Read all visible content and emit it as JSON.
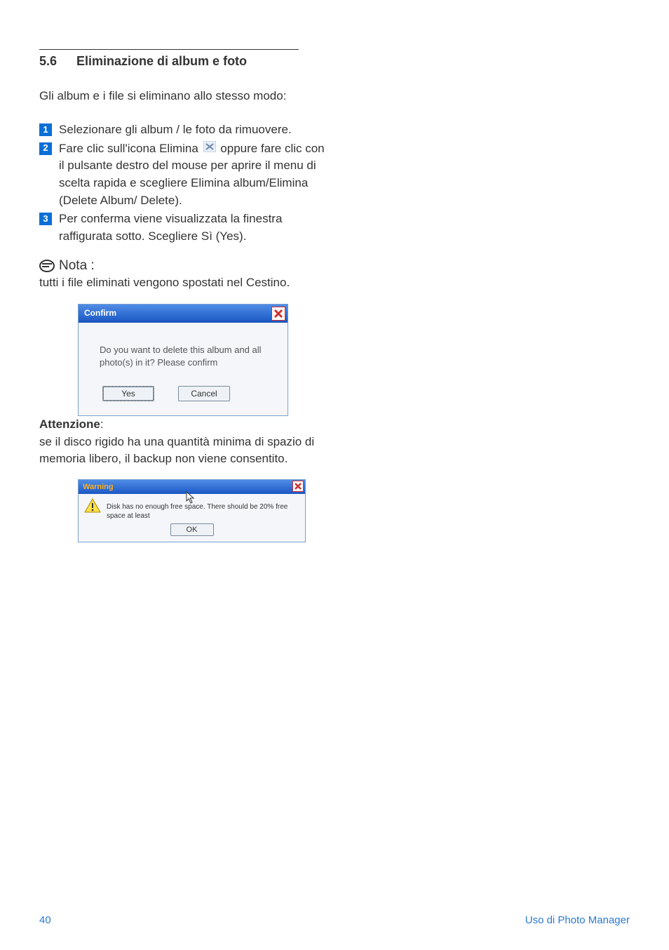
{
  "heading": {
    "number": "5.6",
    "title": "Eliminazione di album e foto"
  },
  "intro": "Gli album e i file si eliminano allo stesso modo:",
  "steps": {
    "s1": {
      "num": "1",
      "text": "Selezionare gli album / le foto da rimuovere."
    },
    "s2": {
      "num": "2",
      "pre": "Fare clic sull'icona Elimina ",
      "post": " oppure fare clic con il pulsante destro del mouse per aprire il menu di scelta rapida e scegliere Elimina album/Elimina (Delete Album/ Delete)."
    },
    "s3": {
      "num": "3",
      "text": "Per conferma viene visualizzata la finestra raffigurata sotto. Scegliere Sì (Yes)."
    }
  },
  "note": {
    "label": "Nota :",
    "body": " tutti i file eliminati vengono spostati nel Cestino."
  },
  "confirm_dialog": {
    "title": "Confirm",
    "message": "Do you want to delete this album and all photo(s) in it? Please confirm",
    "yes": "Yes",
    "cancel": "Cancel"
  },
  "attention": {
    "label": "Attenzione",
    "colon": ":",
    "body": "se il disco rigido ha una quantità minima di spazio di memoria libero, il backup non viene consentito."
  },
  "warning_dialog": {
    "title": "Warning",
    "message": "Disk has no enough free space. There should be 20%  free space at least",
    "ok": "OK"
  },
  "footer": {
    "page": "40",
    "source": "Uso di Photo Manager"
  }
}
